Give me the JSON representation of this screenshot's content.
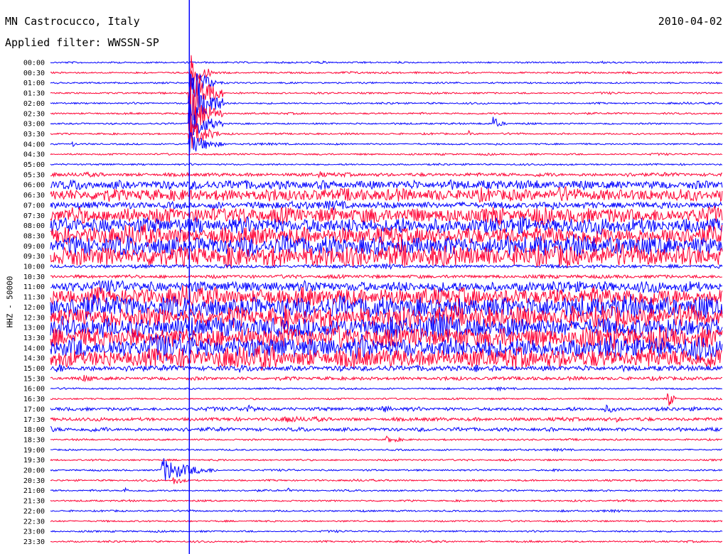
{
  "header": {
    "station": "MN Castrocucco, Italy",
    "filter": "Applied filter: WWSSN-SP",
    "date": "2010-04-02",
    "channel": "HHZ - 50000"
  },
  "colors": {
    "odd": "#0000ff",
    "even": "#ff0033",
    "marker": "#0000ff"
  },
  "chart_data": {
    "type": "line",
    "title": "MN Castrocucco, Italy",
    "subtitle": "Applied filter: WWSSN-SP",
    "ylabel": "HHZ - 50000",
    "xlabel": "",
    "grid": false,
    "y_tick_labels": [
      "00:00",
      "00:30",
      "01:00",
      "01:30",
      "02:00",
      "02:30",
      "03:00",
      "03:30",
      "04:00",
      "04:30",
      "05:00",
      "05:30",
      "06:00",
      "06:30",
      "07:00",
      "07:30",
      "08:00",
      "08:30",
      "09:00",
      "09:30",
      "10:00",
      "10:30",
      "11:00",
      "11:30",
      "12:00",
      "12:30",
      "13:00",
      "13:30",
      "14:00",
      "14:30",
      "15:00",
      "15:30",
      "16:00",
      "16:30",
      "17:00",
      "17:30",
      "18:00",
      "18:30",
      "19:00",
      "19:30",
      "20:00",
      "20:30",
      "21:00",
      "21:30",
      "22:00",
      "22:30",
      "23:00",
      "23:30"
    ],
    "x_range_minutes": [
      0,
      30
    ],
    "event_marker_minute": 6.2,
    "noise_amplitude": [
      1,
      1,
      1,
      1,
      1,
      1,
      1,
      1,
      1,
      1,
      1,
      2,
      5,
      7,
      4,
      9,
      9,
      10,
      11,
      12,
      2,
      2,
      6,
      10,
      12,
      12,
      12,
      12,
      12,
      11,
      3,
      2,
      1,
      1,
      2,
      2,
      2,
      1,
      1,
      1,
      1,
      1,
      1,
      1,
      1,
      1,
      1,
      1
    ],
    "events": [
      {
        "trace": "00:30",
        "minute": 6.2,
        "amplitude": 30,
        "duration": 1.0
      },
      {
        "trace": "01:00",
        "minute": 6.2,
        "amplitude": 40,
        "duration": 1.2
      },
      {
        "trace": "01:30",
        "minute": 6.2,
        "amplitude": 45,
        "duration": 1.5
      },
      {
        "trace": "02:00",
        "minute": 6.2,
        "amplitude": 50,
        "duration": 1.6
      },
      {
        "trace": "02:30",
        "minute": 6.2,
        "amplitude": 40,
        "duration": 1.5
      },
      {
        "trace": "03:00",
        "minute": 6.2,
        "amplitude": 30,
        "duration": 1.5
      },
      {
        "trace": "03:00",
        "minute": 19.8,
        "amplitude": 9,
        "duration": 0.6
      },
      {
        "trace": "03:30",
        "minute": 6.2,
        "amplitude": 25,
        "duration": 1.4
      },
      {
        "trace": "03:30",
        "minute": 18.7,
        "amplitude": 4,
        "duration": 0.2
      },
      {
        "trace": "04:00",
        "minute": 6.2,
        "amplitude": 18,
        "duration": 1.6
      },
      {
        "trace": "04:00",
        "minute": 1.0,
        "amplitude": 4,
        "duration": 0.3
      },
      {
        "trace": "05:30",
        "minute": 12.0,
        "amplitude": 5,
        "duration": 1.2
      },
      {
        "trace": "15:00",
        "minute": 0.3,
        "amplitude": 8,
        "duration": 1.0
      },
      {
        "trace": "15:00",
        "minute": 8.5,
        "amplitude": 6,
        "duration": 0.6
      },
      {
        "trace": "15:00",
        "minute": 19.0,
        "amplitude": 6,
        "duration": 0.5
      },
      {
        "trace": "15:30",
        "minute": 1.5,
        "amplitude": 6,
        "duration": 1.0
      },
      {
        "trace": "16:00",
        "minute": 20.0,
        "amplitude": 3,
        "duration": 0.6
      },
      {
        "trace": "16:30",
        "minute": 27.6,
        "amplitude": 12,
        "duration": 0.4
      },
      {
        "trace": "17:00",
        "minute": 8.8,
        "amplitude": 6,
        "duration": 1.4
      },
      {
        "trace": "17:00",
        "minute": 14.8,
        "amplitude": 6,
        "duration": 1.2
      },
      {
        "trace": "17:00",
        "minute": 24.8,
        "amplitude": 6,
        "duration": 1.4
      },
      {
        "trace": "17:30",
        "minute": 10.5,
        "amplitude": 7,
        "duration": 1.5
      },
      {
        "trace": "17:30",
        "minute": 25.3,
        "amplitude": 4,
        "duration": 0.8
      },
      {
        "trace": "18:00",
        "minute": 0.0,
        "amplitude": 5,
        "duration": 0.6
      },
      {
        "trace": "18:00",
        "minute": 2.5,
        "amplitude": 4,
        "duration": 0.3
      },
      {
        "trace": "18:30",
        "minute": 15.0,
        "amplitude": 5,
        "duration": 1.5
      },
      {
        "trace": "20:00",
        "minute": 5.0,
        "amplitude": 18,
        "duration": 2.5
      },
      {
        "trace": "20:00",
        "minute": 22.4,
        "amplitude": 3,
        "duration": 1.0
      },
      {
        "trace": "20:30",
        "minute": 5.5,
        "amplitude": 6,
        "duration": 1.0
      },
      {
        "trace": "21:00",
        "minute": 3.3,
        "amplitude": 6,
        "duration": 0.3
      },
      {
        "trace": "21:00",
        "minute": 10.6,
        "amplitude": 4,
        "duration": 0.3
      }
    ]
  }
}
